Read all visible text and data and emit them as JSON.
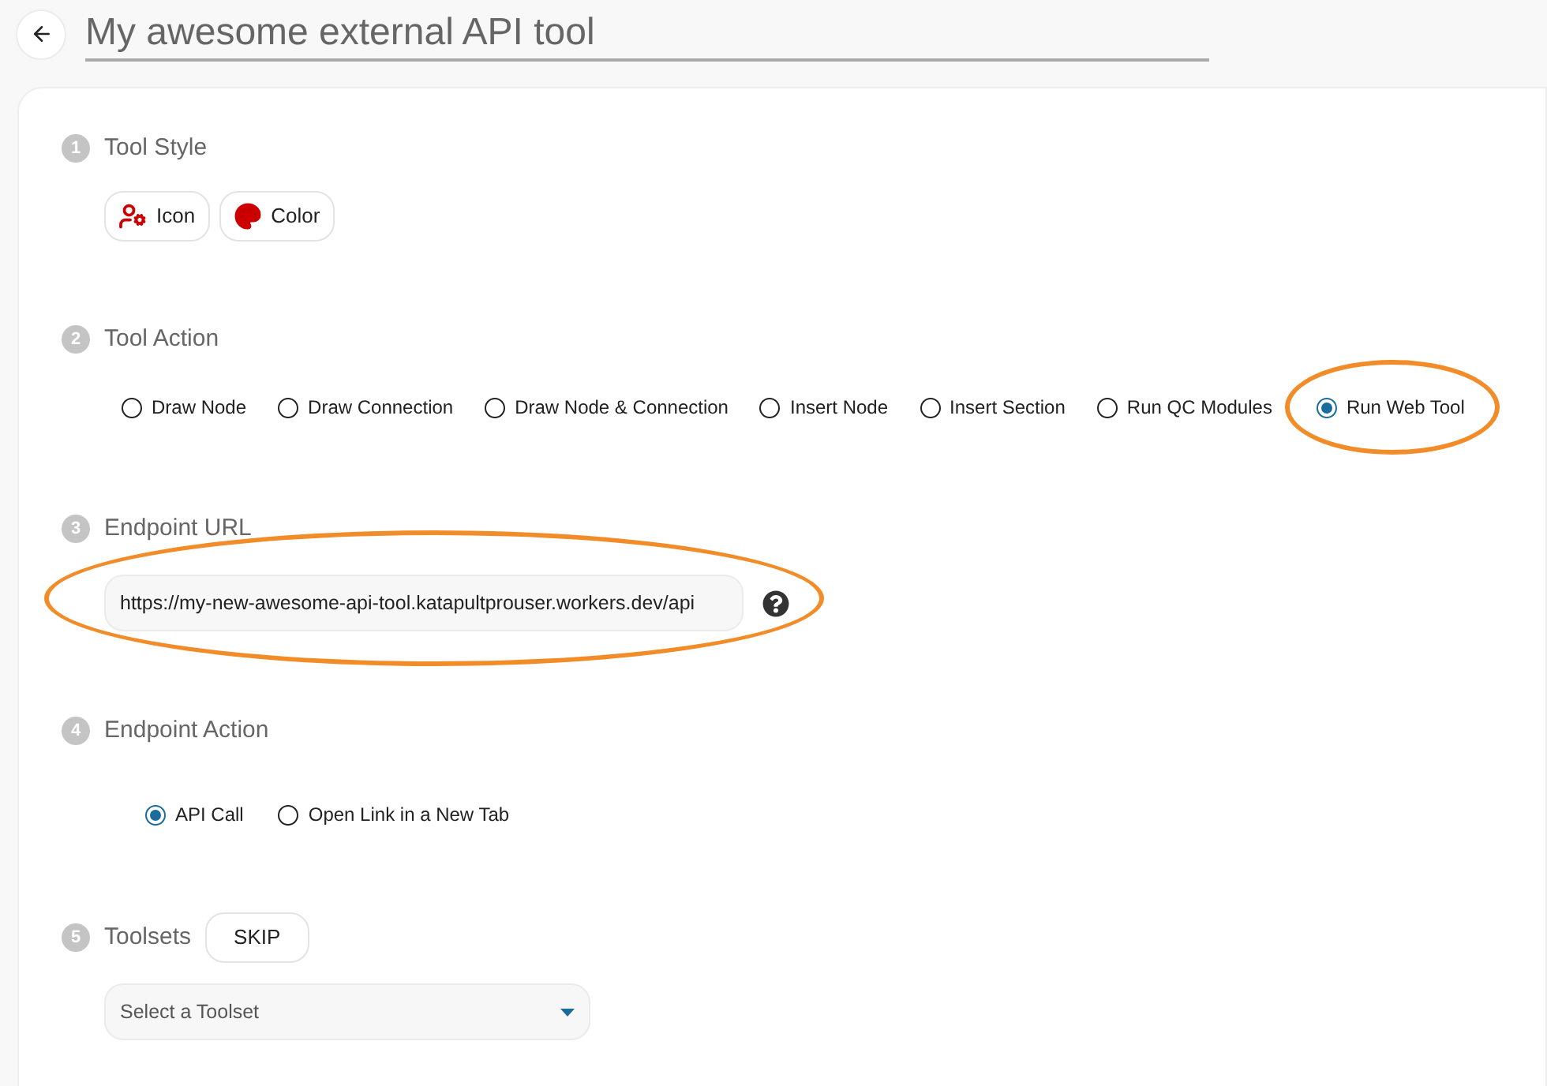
{
  "header": {
    "title": "My awesome external API tool"
  },
  "sections": [
    {
      "number": "1",
      "label": "Tool Style",
      "kind": "style_buttons",
      "buttons": [
        {
          "label": "Icon",
          "kind": "icon"
        },
        {
          "label": "Color",
          "kind": "color"
        }
      ]
    },
    {
      "number": "2",
      "label": "Tool Action",
      "kind": "radios",
      "options": [
        {
          "label": "Draw Node",
          "selected": false,
          "highlighted": false
        },
        {
          "label": "Draw Connection",
          "selected": false,
          "highlighted": false
        },
        {
          "label": "Draw Node & Connection",
          "selected": false,
          "highlighted": false
        },
        {
          "label": "Insert Node",
          "selected": false,
          "highlighted": false
        },
        {
          "label": "Insert Section",
          "selected": false,
          "highlighted": false
        },
        {
          "label": "Run QC Modules",
          "selected": false,
          "highlighted": false
        },
        {
          "label": "Run Web Tool",
          "selected": true,
          "highlighted": true
        }
      ]
    },
    {
      "number": "3",
      "label": "Endpoint URL",
      "kind": "url",
      "value": "https://my-new-awesome-api-tool.katapultprouser.workers.dev/api",
      "highlighted": true
    },
    {
      "number": "4",
      "label": "Endpoint Action",
      "kind": "radios",
      "options": [
        {
          "label": "API Call",
          "selected": true,
          "highlighted": false
        },
        {
          "label": "Open Link in a New Tab",
          "selected": false,
          "highlighted": false
        }
      ]
    },
    {
      "number": "5",
      "label": "Toolsets",
      "kind": "select",
      "skip": "SKIP",
      "placeholder": "Select a Toolset"
    }
  ]
}
